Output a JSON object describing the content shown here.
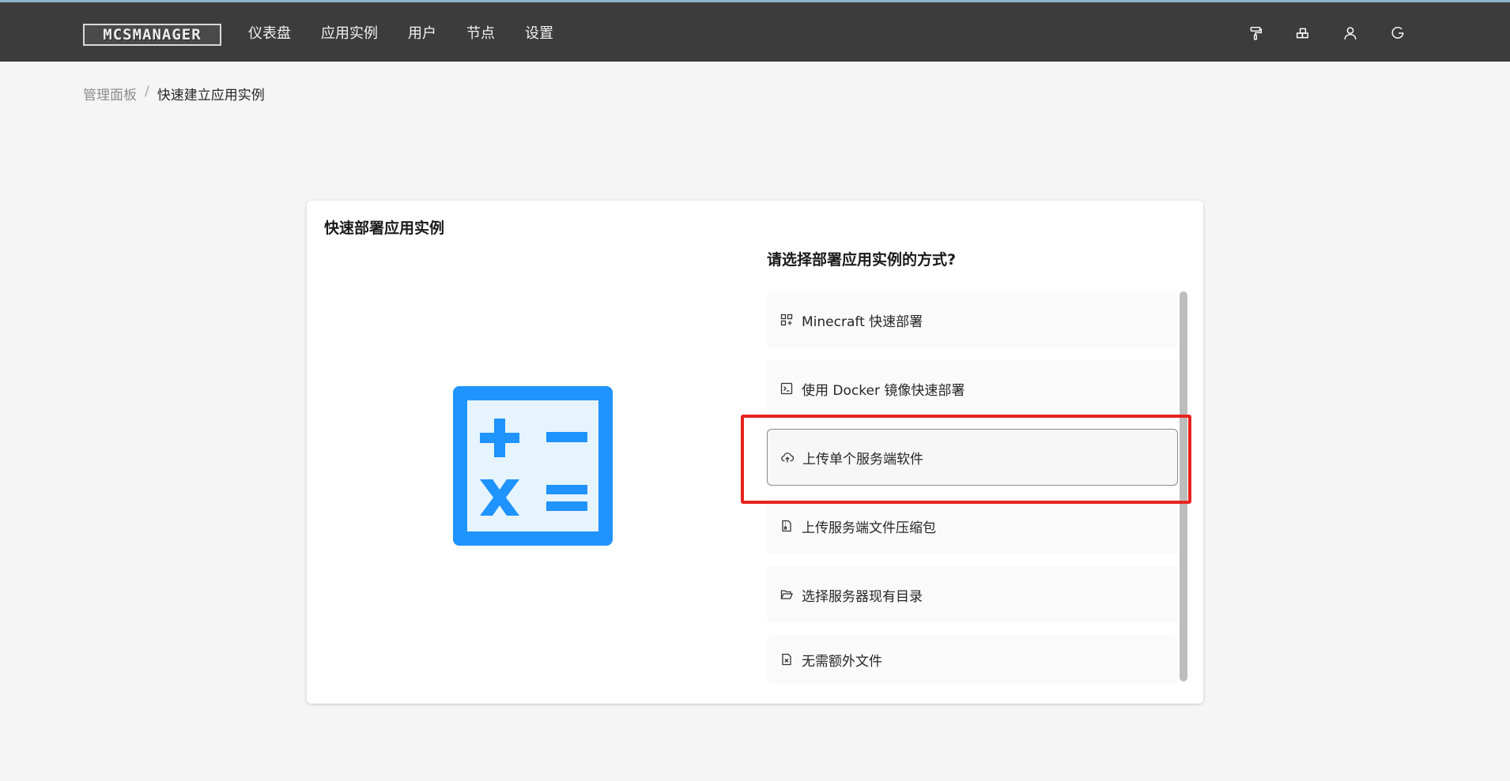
{
  "header": {
    "logo_text": "MCSMANAGER",
    "nav": [
      "仪表盘",
      "应用实例",
      "用户",
      "节点",
      "设置"
    ],
    "icons": [
      "paint-roller-icon",
      "blocks-icon",
      "user-icon",
      "logout-icon"
    ]
  },
  "breadcrumb": {
    "home": "管理面板",
    "separator": "/",
    "current": "快速建立应用实例"
  },
  "card": {
    "title": "快速部署应用实例",
    "illustration": "calculator-icon",
    "question": "请选择部署应用实例的方式?",
    "options": [
      {
        "label": "Minecraft 快速部署",
        "icon": "app-grid-icon"
      },
      {
        "label": "使用 Docker 镜像快速部署",
        "icon": "terminal-icon"
      },
      {
        "label": "上传单个服务端软件",
        "icon": "cloud-upload-icon",
        "selected": true
      },
      {
        "label": "上传服务端文件压缩包",
        "icon": "file-zip-icon"
      },
      {
        "label": "选择服务器现有目录",
        "icon": "folder-open-icon"
      },
      {
        "label": "无需额外文件",
        "icon": "file-x-icon"
      }
    ]
  },
  "colors": {
    "navbar": "#3c3c3c",
    "page_background": "#f5f5f5",
    "accent_blue": "#1f93ff",
    "highlight_red": "#e8231f"
  }
}
